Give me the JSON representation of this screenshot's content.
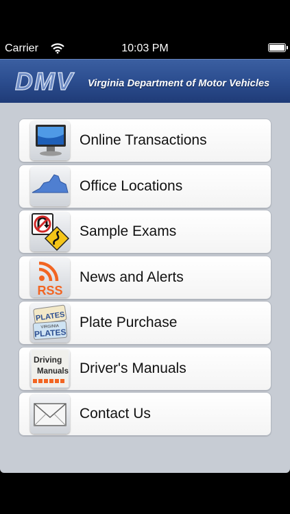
{
  "status": {
    "carrier": "Carrier",
    "time": "10:03 PM"
  },
  "header": {
    "logo_text": "DMV",
    "title": "Virginia Department of Motor Vehicles"
  },
  "menu": [
    {
      "label": "Online Transactions",
      "icon": "computer-monitor-icon"
    },
    {
      "label": "Office Locations",
      "icon": "virginia-map-icon"
    },
    {
      "label": "Sample Exams",
      "icon": "road-signs-icon"
    },
    {
      "label": "News and Alerts",
      "icon": "rss-icon"
    },
    {
      "label": "Plate Purchase",
      "icon": "license-plates-icon"
    },
    {
      "label": "Driver's Manuals",
      "icon": "driving-manuals-icon"
    },
    {
      "label": "Contact Us",
      "icon": "envelope-icon"
    }
  ],
  "icon_text": {
    "rss": "RSS",
    "plate_top": "VIRGINIA",
    "plate_bottom": "PLATES",
    "manual_line1": "Driving",
    "manual_line2": "Manuals"
  },
  "colors": {
    "header": "#2d4f91",
    "background": "#c7ccd4",
    "rss_orange": "#f26522"
  }
}
